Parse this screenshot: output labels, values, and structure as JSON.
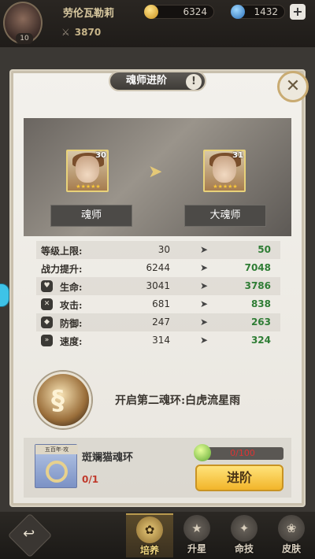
{
  "header": {
    "player_name": "劳伦瓦勒莉",
    "level": "10",
    "power": "3870",
    "gold": "6324",
    "gems": "1432",
    "plus_label": "+"
  },
  "dialog": {
    "title": "魂师进阶",
    "info_label": "!",
    "close_label": "✕"
  },
  "stage": {
    "left": {
      "rank": "魂师",
      "level": "30",
      "stars": "★★★★★"
    },
    "right": {
      "rank": "大魂师",
      "level": "31",
      "stars": "★★★★★"
    }
  },
  "stats": [
    {
      "name": "等级上限:",
      "current": "30",
      "next": "50",
      "icon": ""
    },
    {
      "name": "战力提升:",
      "current": "6244",
      "next": "7048",
      "icon": ""
    },
    {
      "name": "生命:",
      "current": "3041",
      "next": "3786",
      "icon": "heart-icon"
    },
    {
      "name": "攻击:",
      "current": "681",
      "next": "838",
      "icon": "attack-icon"
    },
    {
      "name": "防御:",
      "current": "247",
      "next": "263",
      "icon": "shield-icon"
    },
    {
      "name": "速度:",
      "current": "314",
      "next": "324",
      "icon": "speed-icon"
    }
  ],
  "unlock": {
    "text": "开启第二魂环:白虎流星雨"
  },
  "material": {
    "tag": "五百年·攻",
    "name": "斑斓猫魂环",
    "count": "0/1",
    "progress_text": "0/100",
    "progress_value": 0
  },
  "action": {
    "advance_label": "进阶"
  },
  "nav": {
    "back_label": "↩",
    "items": [
      {
        "label": "培养",
        "active": true
      },
      {
        "label": "升星",
        "active": false
      },
      {
        "label": "命技",
        "active": false
      },
      {
        "label": "皮肤",
        "active": false
      }
    ]
  },
  "colors": {
    "increase": "#2f7d35",
    "insufficient": "#c0392b",
    "button_gold": "#f2b52a"
  }
}
